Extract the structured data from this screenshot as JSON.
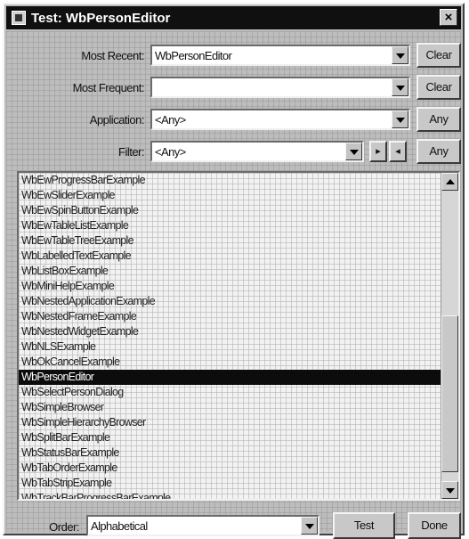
{
  "window": {
    "title": "Test: WbPersonEditor",
    "close_glyph": "×"
  },
  "fields": {
    "most_recent": {
      "label": "Most Recent:",
      "value": "WbPersonEditor",
      "button": "Clear"
    },
    "most_frequent": {
      "label": "Most Frequent:",
      "value": "",
      "button": "Clear"
    },
    "application": {
      "label": "Application:",
      "value": "<Any>",
      "button": "Any"
    },
    "filter": {
      "label": "Filter:",
      "value": "<Any>",
      "button": "Any",
      "next_glyph": "▸",
      "prev_glyph": "◂"
    }
  },
  "list": {
    "items": [
      "WbEwProgressBarExample",
      "WbEwSliderExample",
      "WbEwSpinButtonExample",
      "WbEwTableListExample",
      "WbEwTableTreeExample",
      "WbLabelledTextExample",
      "WbListBoxExample",
      "WbMiniHelpExample",
      "WbNestedApplicationExample",
      "WbNestedFrameExample",
      "WbNestedWidgetExample",
      "WbNLSExample",
      "WbOkCancelExample",
      "WbPersonEditor",
      "WbSelectPersonDialog",
      "WbSimpleBrowser",
      "WbSimpleHierarchyBrowser",
      "WbSplitBarExample",
      "WbStatusBarExample",
      "WbTabOrderExample",
      "WbTabStripExample",
      "WbTrackBarProgressBarExample"
    ],
    "selected": "WbPersonEditor"
  },
  "footer": {
    "order_label": "Order:",
    "order_value": "Alphabetical",
    "test_button": "Test",
    "done_button": "Done"
  },
  "icons": {
    "window_icon": "app-icon",
    "dropdown": "chevron-down-icon",
    "scroll_up": "arrow-up-icon",
    "scroll_down": "arrow-down-icon"
  }
}
